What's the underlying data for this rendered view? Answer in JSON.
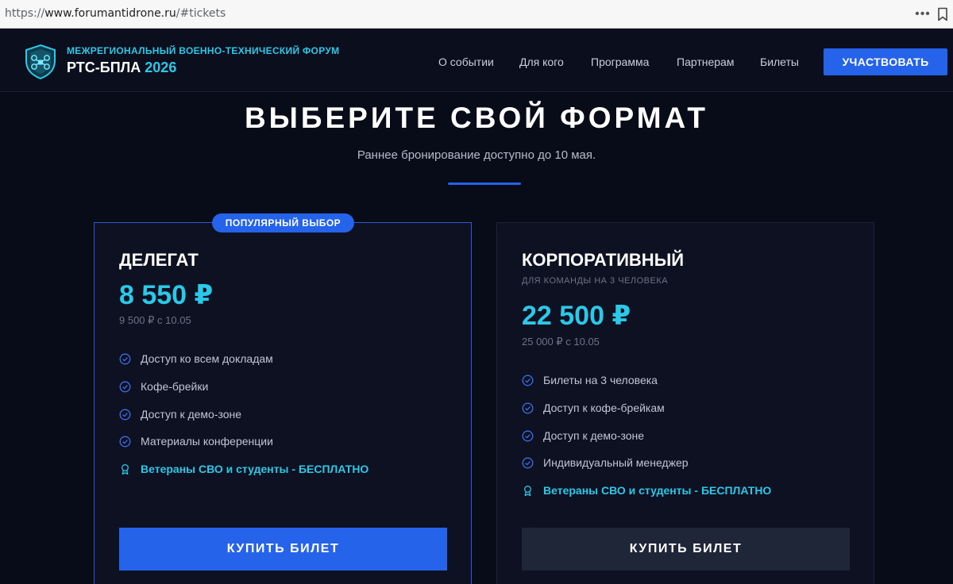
{
  "browser": {
    "url_scheme": "https://",
    "url_host": "www.forumantidrone.ru",
    "url_path": "/#tickets"
  },
  "header": {
    "subtitle": "МЕЖРЕГИОНАЛЬНЫЙ ВОЕННО-ТЕХНИЧЕСКИЙ ФОРУМ",
    "title": "РТС-БПЛА",
    "year": "2026",
    "nav": [
      "О событии",
      "Для кого",
      "Программа",
      "Партнерам",
      "Билеты"
    ],
    "cta_label": "УЧАСТВОВАТЬ"
  },
  "section": {
    "title": "ВЫБЕРИТЕ СВОЙ ФОРМАТ",
    "subtitle": "Раннее бронирование доступно до 10 мая."
  },
  "cards": [
    {
      "badge": "ПОПУЛЯРНЫЙ ВЫБОР",
      "name": "ДЕЛЕГАТ",
      "price": "8 550 ₽",
      "old_price": "9 500 ₽ с 10.05",
      "features": [
        "Доступ ко всем докладам",
        "Кофе-брейки",
        "Доступ к демо-зоне",
        "Материалы конференции"
      ],
      "special": "Ветераны СВО и студенты - БЕСПЛАТНО",
      "button": "КУПИТЬ БИЛЕТ"
    },
    {
      "name": "КОРПОРАТИВНЫЙ",
      "note": "ДЛЯ КОМАНДЫ НА 3 ЧЕЛОВЕКА",
      "price": "22 500 ₽",
      "old_price": "25 000 ₽ с 10.05",
      "features": [
        "Билеты на 3 человека",
        "Доступ к кофе-брейкам",
        "Доступ к демо-зоне",
        "Индивидуальный менеджер"
      ],
      "special": "Ветераны СВО и студенты - БЕСПЛАТНО",
      "button": "КУПИТЬ БИЛЕТ"
    }
  ],
  "colors": {
    "background": "#080b18",
    "accent_blue": "#2563eb",
    "accent_cyan": "#2bc8e8"
  },
  "icons": [
    "shield-drone-logo-icon",
    "more-icon",
    "bookmark-icon",
    "check-circle-icon",
    "award-icon"
  ]
}
